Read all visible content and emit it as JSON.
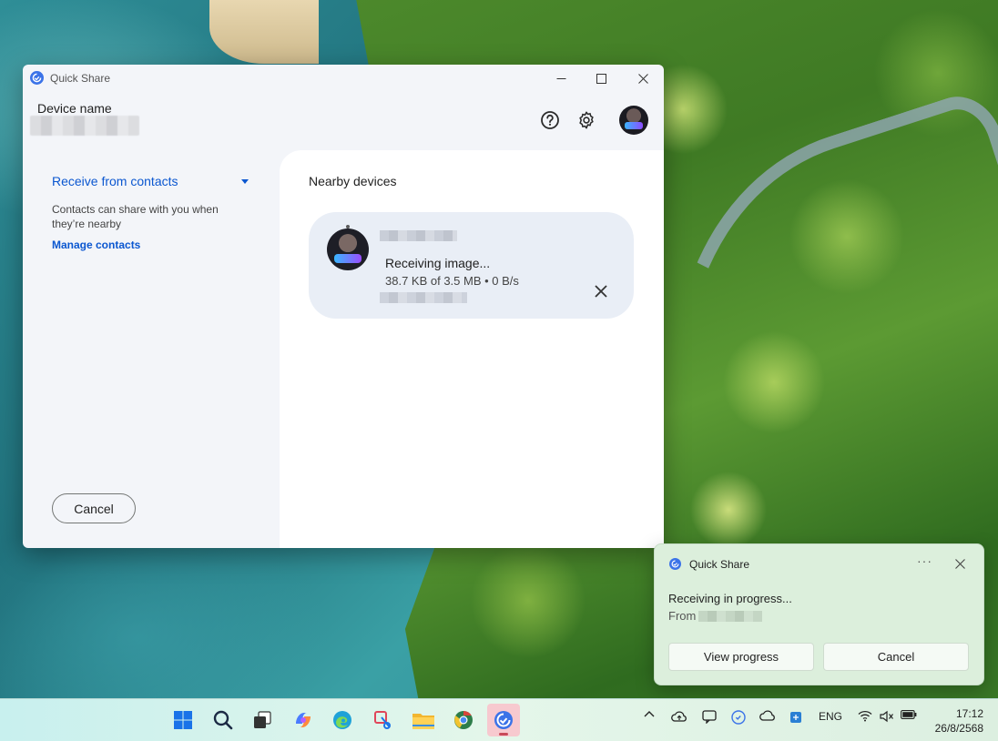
{
  "window": {
    "title": "Quick Share",
    "device_label": "Device name"
  },
  "left_pane": {
    "receive_label": "Receive from contacts",
    "description": "Contacts can share with you when they’re nearby",
    "manage_link": "Manage contacts",
    "cancel_label": "Cancel"
  },
  "right_pane": {
    "nearby_title": "Nearby devices",
    "card": {
      "status": "Receiving image...",
      "progress": "38.7 KB of 3.5 MB • 0 B/s"
    }
  },
  "toast": {
    "app": "Quick Share",
    "more": "···",
    "message": "Receiving in progress...",
    "from_label": "From",
    "view_label": "View progress",
    "cancel_label": "Cancel"
  },
  "taskbar": {
    "apps": [
      "start-icon",
      "search-icon",
      "task-view-icon",
      "copilot-icon",
      "edge-icon",
      "snipping-tool-icon",
      "file-explorer-icon",
      "chrome-icon",
      "quick-share-icon"
    ],
    "tray": {
      "chevron": "^",
      "language": "ENG"
    },
    "clock": {
      "time": "17:12",
      "date": "26/8/2568"
    }
  },
  "colors": {
    "accent": "#0b57d0",
    "card_bg": "#e9eef6",
    "toast_bg": "#dcefdc"
  }
}
